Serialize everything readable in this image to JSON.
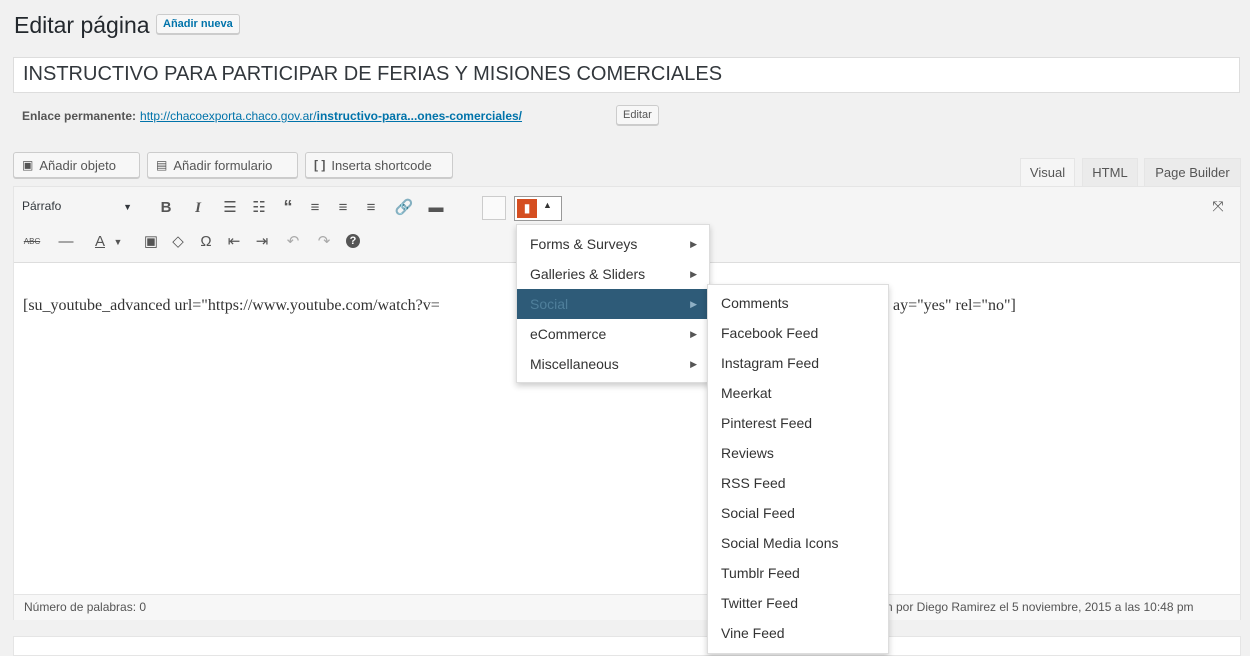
{
  "header": {
    "title": "Editar página",
    "add_new": "Añadir nueva"
  },
  "post_title": "INSTRUCTIVO PARA PARTICIPAR DE FERIAS Y MISIONES COMERCIALES",
  "permalink": {
    "label": "Enlace permanente:",
    "url_prefix": "http://chacoexporta.chaco.gov.ar/",
    "url_slug": "instructivo-para...ones-comerciales/",
    "edit_button": "Editar"
  },
  "media_buttons": {
    "add_object": "Añadir objeto",
    "add_form": "Añadir formulario",
    "insert_shortcode": "Inserta shortcode"
  },
  "editor_tabs": [
    "Visual",
    "HTML",
    "Page Builder"
  ],
  "toolbar": {
    "format_select": "Párrafo",
    "row1": [
      "bold-icon",
      "italic-icon",
      "bullet-list-icon",
      "numbered-list-icon",
      "blockquote-icon",
      "align-left-icon",
      "align-center-icon",
      "align-right-icon",
      "link-icon",
      "read-more-icon",
      "table-icon",
      "plugin-icon"
    ],
    "row2": [
      "strikethrough-icon",
      "horizontal-line-icon",
      "text-color-icon",
      "paste-text-icon",
      "clear-formatting-icon",
      "special-char-icon",
      "outdent-icon",
      "indent-icon",
      "undo-icon",
      "redo-icon",
      "help-icon"
    ]
  },
  "content": {
    "left": "[su_youtube_advanced url=\"https://www.youtube.com/watch?v=",
    "right": "ay=\"yes\" rel=\"no\"]"
  },
  "status_bar": {
    "word_count": "Número de palabras: 0",
    "last_edit": "n por Diego Ramirez el 5 noviembre, 2015 a las 10:48 pm"
  },
  "menu": {
    "items": [
      {
        "label": "Forms & Surveys"
      },
      {
        "label": "Galleries & Sliders"
      },
      {
        "label": "Social"
      },
      {
        "label": "eCommerce"
      },
      {
        "label": "Miscellaneous"
      }
    ],
    "submenu": [
      "Comments",
      "Facebook Feed",
      "Instagram Feed",
      "Meerkat",
      "Pinterest Feed",
      "Reviews",
      "RSS Feed",
      "Social Feed",
      "Social Media Icons",
      "Tumblr Feed",
      "Twitter Feed",
      "Vine Feed"
    ]
  },
  "colors": {
    "link": "#0073aa",
    "highlight": "#2e5b78",
    "plugin_button": "#d54e21"
  }
}
